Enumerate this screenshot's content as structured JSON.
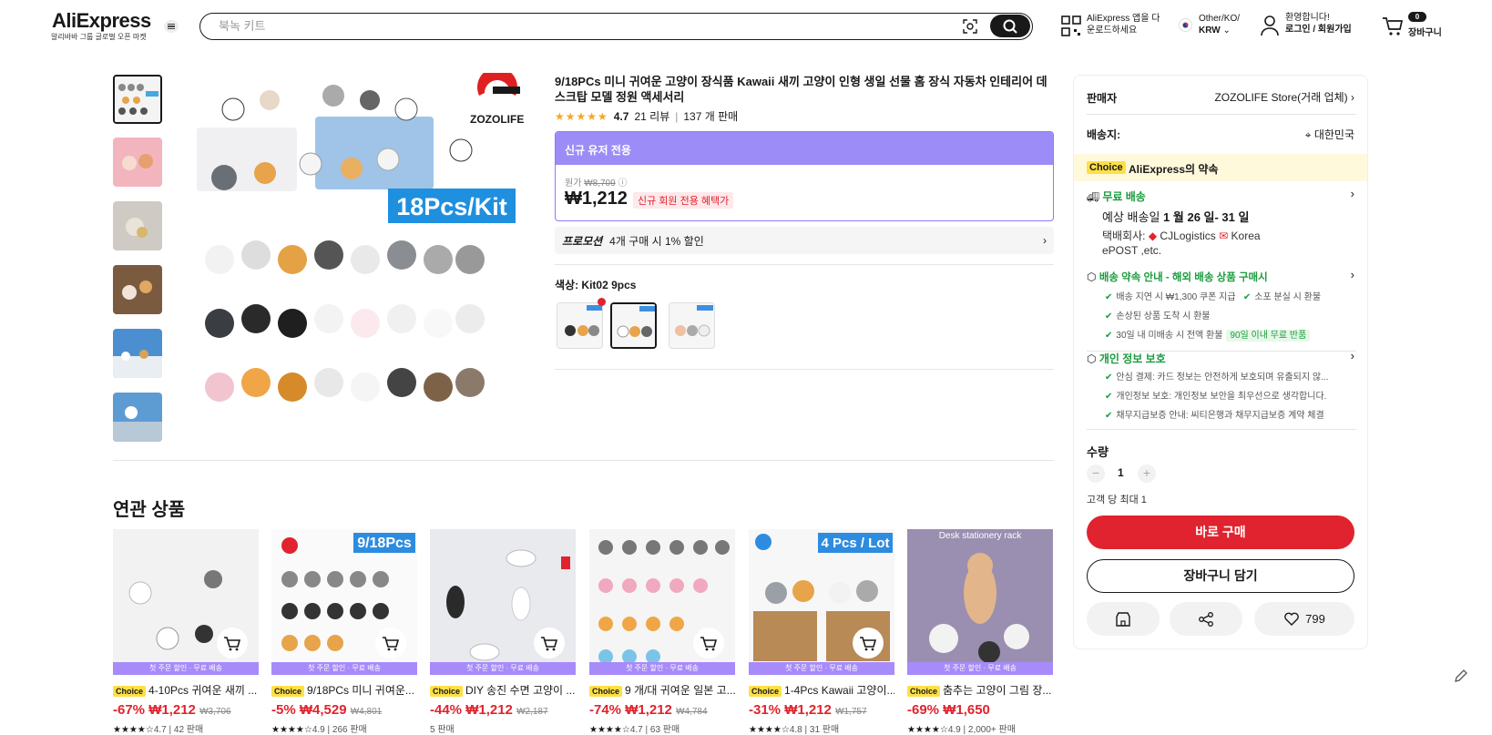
{
  "header": {
    "logo": "AliExpress",
    "logo_sub": "알리바바 그룹 글로벌 오픈 마켓",
    "search_placeholder": "북녹 키트",
    "app_line1": "AliExpress 앱을 다",
    "app_line2": "운로드하세요",
    "lang_line1": "Other/KO/",
    "lang_line2": "KRW",
    "user_line1": "환영합니다!",
    "user_line2": "로그인 / 회원가입",
    "cart_count": "0",
    "cart_label": "장바구니"
  },
  "product": {
    "title": "9/18PCs 미니 귀여운 고양이 장식품 Kawaii 새끼 고양이 인형 생일 선물 홈 장식 자동차 인테리어 데스크탑 모델 정원 액세서리",
    "rating": "4.7",
    "reviews": "21 리뷰",
    "sold": "137 개 판매",
    "promo_header": "신규 유저 전용",
    "orig_label": "원가",
    "orig_price": "₩8,709",
    "price": "₩1,212",
    "new_user_badge": "신규 회원 전용 혜택가",
    "promotion_label": "프로모션",
    "promotion_text": "4개 구매 시 1% 할인",
    "color_label": "색상: Kit02 9pcs",
    "image_brand": "ZOZOLIFE",
    "image_banner": "18Pcs/Kit"
  },
  "related": {
    "title": "연관 상품",
    "strip_text": "첫 주문 할인 · 무료 배송",
    "choice": "Choice",
    "items": [
      {
        "title": "4-10Pcs 귀여운 새끼 ...",
        "discount": "-67%",
        "price": "₩1,212",
        "orig": "₩3,706",
        "meta": "4.7 | 42 판매"
      },
      {
        "title": "9/18PCs 미니 귀여운...",
        "discount": "-5%",
        "price": "₩4,529",
        "orig": "₩4,801",
        "meta": "4.9 | 266 판매"
      },
      {
        "title": "DIY 송진 수면 고양이 ...",
        "discount": "-44%",
        "price": "₩1,212",
        "orig": "₩2,187",
        "meta": "5 판매"
      },
      {
        "title": "9 개/대 귀여운 일본 고...",
        "discount": "-74%",
        "price": "₩1,212",
        "orig": "₩4,784",
        "meta": "4.7 | 63 판매"
      },
      {
        "title": "1-4Pcs Kawaii 고양이...",
        "discount": "-31%",
        "price": "₩1,212",
        "orig": "₩1,757",
        "meta": "4.8 | 31 판매"
      },
      {
        "title": "춤추는 고양이 그림 장...",
        "discount": "-69%",
        "price": "₩1,650",
        "orig": "",
        "meta": "4.9 | 2,000+ 판매"
      }
    ],
    "banner2": "9/18Pcs",
    "banner5": "4 Pcs / Lot",
    "banner6": "Desk stationery rack"
  },
  "panel": {
    "seller_label": "판매자",
    "seller_name": "ZOZOLIFE Store(거래 업체)",
    "ship_label": "배송지:",
    "ship_dest": "대한민국",
    "choice_tag": "Choice",
    "choice_promise": "AliExpress의 약속",
    "free_ship": "무료 배송",
    "eta_prefix": "예상 배송일",
    "eta_dates": "1 월 26 일- 31 일",
    "carrier_prefix": "택배회사:",
    "carrier_1": "CJLogistics",
    "carrier_2": "Korea",
    "carrier_3": "ePOST ,etc.",
    "promise_title": "배송 약속 안내 - 해외 배송 상품 구매시",
    "promise_1a": "배송 지연 시 ₩1,300 쿠폰 지급",
    "promise_1b": "소포 분실 시 환불",
    "promise_2": "손상된 상품 도착 시 환불",
    "promise_3": "30일 내 미배송 시 전액 환불",
    "promise_3_badge": "90일 이내 무료 반품",
    "privacy_title": "개인 정보 보호",
    "privacy_1": "안심 결제: 카드 정보는 안전하게 보호되며 유출되지 않...",
    "privacy_2": "개인정보 보호: 개인정보 보안을 최우선으로 생각합니다.",
    "privacy_3": "채무지급보증 안내: 씨티은행과 채무지급보증 계약 체결",
    "qty_label": "수량",
    "qty_value": "1",
    "qty_limit": "고객 당 최대 1",
    "buy_now": "바로 구매",
    "add_cart": "장바구니 담기",
    "wish_count": "799"
  },
  "colors": {
    "accent_red": "#e0232e",
    "promo_purple": "#9b8cf7",
    "choice_yellow": "#fee046",
    "green": "#1a9c3e"
  }
}
